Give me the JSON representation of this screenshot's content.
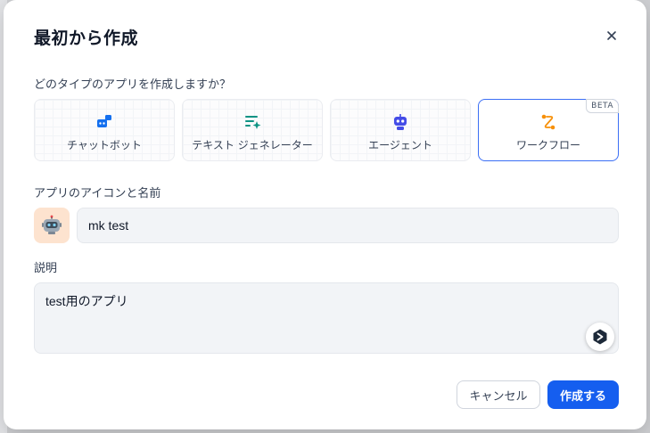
{
  "dialog": {
    "title": "最初から作成",
    "close_icon": "close-icon",
    "question": "どのタイプのアプリを作成しますか？",
    "app_types": [
      {
        "label": "チャットボット",
        "icon": "chatbot-icon",
        "color": "#1570ef",
        "selected": false
      },
      {
        "label": "テキスト ジェネレーター",
        "icon": "text-generator-icon",
        "color": "#0e9384",
        "selected": false
      },
      {
        "label": "エージェント",
        "icon": "agent-icon",
        "color": "#444ce7",
        "selected": false
      },
      {
        "label": "ワークフロー",
        "icon": "workflow-icon",
        "color": "#f79009",
        "selected": true,
        "badge": "BETA"
      }
    ],
    "name_section": {
      "label": "アプリのアイコンと名前",
      "avatar_icon": "robot-icon",
      "value": "mk test"
    },
    "description_section": {
      "label": "説明",
      "value": "test用のアプリ",
      "assist_icon": "assistant-icon"
    },
    "buttons": {
      "cancel": "キャンセル",
      "create": "作成する"
    },
    "colors": {
      "primary": "#155eef",
      "selected_border": "#3b6ff5",
      "avatar_bg": "#fde3cf"
    }
  }
}
